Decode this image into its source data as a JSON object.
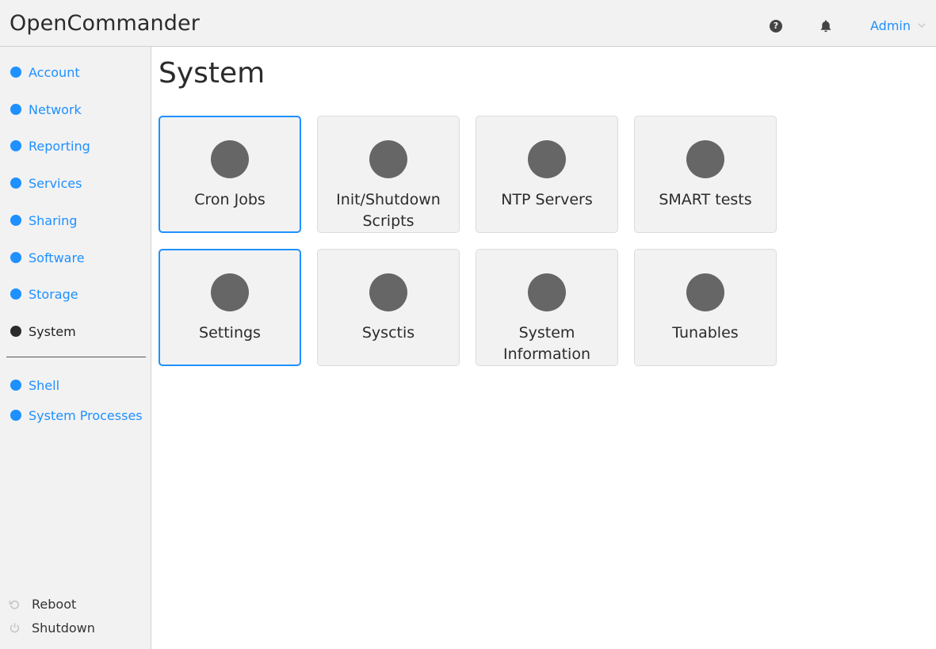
{
  "app": {
    "title": "OpenCommander",
    "help_icon": "question-circle-icon",
    "help_glyph": "?",
    "notifications_icon": "bell-icon",
    "user_menu_label": "Admin",
    "accent_color": "#1e90ff"
  },
  "sidebar": {
    "items": [
      {
        "label": "Account",
        "active": false
      },
      {
        "label": "Network",
        "active": false
      },
      {
        "label": "Reporting",
        "active": false
      },
      {
        "label": "Services",
        "active": false
      },
      {
        "label": "Sharing",
        "active": false
      },
      {
        "label": "Software",
        "active": false
      },
      {
        "label": "Storage",
        "active": false
      },
      {
        "label": "System",
        "active": true
      }
    ],
    "tools": [
      {
        "label": "Shell"
      },
      {
        "label": "System Processes"
      }
    ],
    "power": {
      "reboot_label": "Reboot",
      "shutdown_label": "Shutdown"
    }
  },
  "main": {
    "title": "System",
    "tiles": [
      {
        "label": "Cron Jobs",
        "icon": "circle-icon"
      },
      {
        "label": "Init/Shutdown Scripts",
        "icon": "circle-icon"
      },
      {
        "label": "NTP Servers",
        "icon": "circle-icon"
      },
      {
        "label": "SMART tests",
        "icon": "circle-icon"
      },
      {
        "label": "Settings",
        "icon": "circle-icon"
      },
      {
        "label": "Sysctis",
        "icon": "circle-icon"
      },
      {
        "label": "System Information",
        "icon": "circle-icon"
      },
      {
        "label": "Tunables",
        "icon": "circle-icon"
      }
    ]
  }
}
